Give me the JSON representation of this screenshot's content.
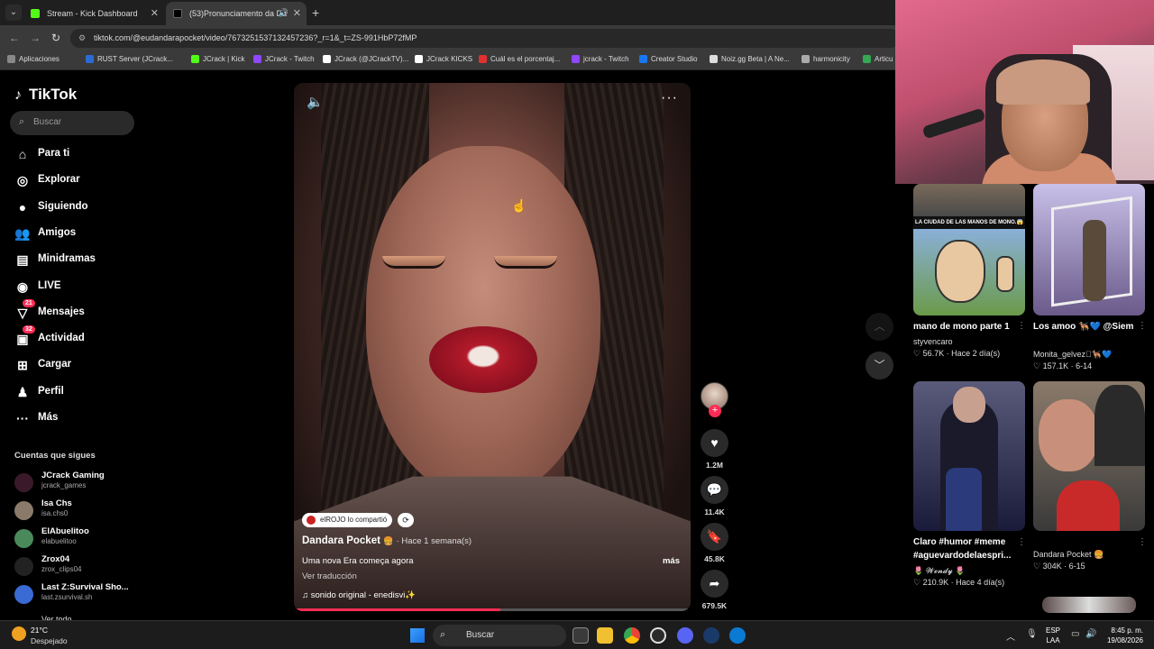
{
  "browser": {
    "tabs": [
      {
        "title": "Stream - Kick Dashboard",
        "favicon_color": "#53fc18"
      },
      {
        "title": "(53)Pronunciamento da Da",
        "favicon_color": "#000000"
      }
    ],
    "url": "tiktok.com/@eudandarapocket/video/7673251537132457236?_r=1&_t=ZS-991HbP72fMP",
    "bookmarks": [
      {
        "label": "Aplicaciones",
        "color": "#888888"
      },
      {
        "label": "RUST Server (JCrack...",
        "color": "#2b6cd4"
      },
      {
        "label": "JCrack | Kick",
        "color": "#53fc18"
      },
      {
        "label": "JCrack - Twitch",
        "color": "#9146ff"
      },
      {
        "label": "JCrack (@JCrackTV)...",
        "color": "#ffffff"
      },
      {
        "label": "JCrack KICKS",
        "color": "#ffffff"
      },
      {
        "label": "Cuál es el porcentaj...",
        "color": "#e03030"
      },
      {
        "label": "jcrack - Twitch",
        "color": "#9146ff"
      },
      {
        "label": "Creator Studio",
        "color": "#1877f2"
      },
      {
        "label": "Noiz.gg Beta | A Ne...",
        "color": "#dddddd"
      },
      {
        "label": "harmonicity",
        "color": "#aaaaaa"
      },
      {
        "label": "Articu",
        "color": "#34a853"
      }
    ]
  },
  "sidebar": {
    "logo": "TikTok",
    "search_placeholder": "Buscar",
    "nav": [
      {
        "label": "Para ti",
        "icon": "home-icon"
      },
      {
        "label": "Explorar",
        "icon": "compass-icon"
      },
      {
        "label": "Siguiendo",
        "icon": "following-icon"
      },
      {
        "label": "Amigos",
        "icon": "friends-icon"
      },
      {
        "label": "Minidramas",
        "icon": "film-icon"
      },
      {
        "label": "LIVE",
        "icon": "live-icon"
      },
      {
        "label": "Mensajes",
        "icon": "messages-icon",
        "badge": "21"
      },
      {
        "label": "Actividad",
        "icon": "activity-icon",
        "badge": "32"
      },
      {
        "label": "Cargar",
        "icon": "upload-icon"
      },
      {
        "label": "Perfil",
        "icon": "profile-icon"
      },
      {
        "label": "Más",
        "icon": "more-icon"
      }
    ],
    "following_title": "Cuentas que sigues",
    "following": [
      {
        "name": "JCrack Gaming",
        "handle": "jcrack_games",
        "color": "#3a1a2a"
      },
      {
        "name": "Isa Chs",
        "handle": "isa.chs0",
        "color": "#8a7a6a"
      },
      {
        "name": "ElAbuelitoo",
        "handle": "elabuelitoo",
        "color": "#4a8a5a"
      },
      {
        "name": "Zrox04",
        "handle": "zrox_clips04",
        "color": "#222222"
      },
      {
        "name": "Last Z:Survival Sho...",
        "handle": "last.zsurvival.sh",
        "color": "#3a6ad4"
      }
    ],
    "see_all": "Ver todo"
  },
  "video": {
    "shared_by": "elROJO lo compartió",
    "author": "Dandara Pocket",
    "time_ago": "· Hace 1 semana(s)",
    "caption": "Uma nova Era começa agora",
    "more": "más",
    "translate": "Ver traducción",
    "sound": "♫  sonido original - enedisvi✨",
    "progress": 0.52,
    "likes": "1.2M",
    "comments": "11.4K",
    "saves": "45.8K",
    "shares": "679.5K"
  },
  "recommendations": [
    {
      "title": "mano de mono parte 1",
      "user": "styvencaro",
      "likes": "♡ 56.7K",
      "date": "Hace 2 día(s)",
      "banner": "LA CIUDAD DE LAS MANOS DE MONO.😱"
    },
    {
      "title": "Los amoo 🐕‍🦺💙 @Siempre Blessd 🎲 ...",
      "user": "Monita_gelvez🏽🐕‍🦺💙",
      "likes": "♡ 157.1K",
      "date": "6-14"
    },
    {
      "title": "Claro #humor #meme",
      "title2": "#aguevardodelaespri...",
      "user": "🌷 𝓦𝓮𝓷𝓭𝔂 🌷",
      "likes": "♡ 210.9K",
      "date": "Hace 4 día(s)"
    },
    {
      "title": "",
      "user": "Dandara Pocket 🍔",
      "likes": "♡ 304K",
      "date": "6-15"
    }
  ],
  "taskbar": {
    "temp": "21°C",
    "weather": "Despejado",
    "search": "Buscar",
    "lang1": "ESP",
    "lang2": "LAA",
    "time": "8:45 p. m.",
    "date": "19/08/2026"
  }
}
